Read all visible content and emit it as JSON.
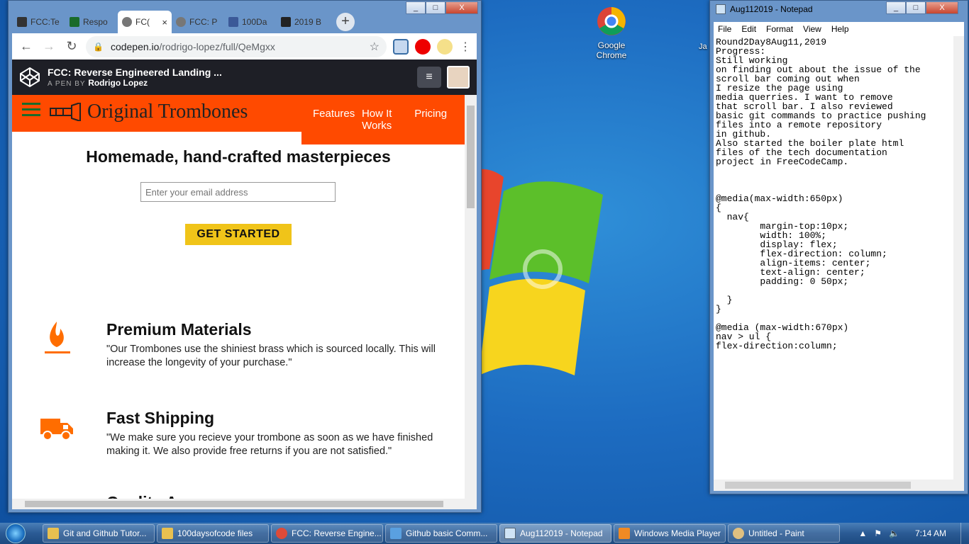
{
  "desktop": {
    "icons": [
      {
        "label_line1": "Google",
        "label_line2": "Chrome"
      }
    ],
    "edge_partial": "Ja"
  },
  "chrome": {
    "window_controls": [
      "_",
      "□",
      "X"
    ],
    "tabs": [
      {
        "label": "FCC:Te",
        "fav_color": "#333333"
      },
      {
        "label": "Respo",
        "fav_color": "#1a6b2a"
      },
      {
        "label": "FC(",
        "fav_color": "#555555",
        "active": true
      },
      {
        "label": "FCC: P",
        "fav_color": "#555555"
      },
      {
        "label": "100Da",
        "fav_color": "#3b5998"
      },
      {
        "label": "2019 B",
        "fav_color": "#222222"
      }
    ],
    "new_tab": "+",
    "url_host": "codepen.io",
    "url_path": "/rodrigo-lopez/full/QeMgxx",
    "codepen": {
      "title": "FCC: Reverse Engineered Landing ...",
      "by_label": "A PEN BY",
      "author": "Rodrigo Lopez"
    },
    "page": {
      "brand": "Original Trombones",
      "nav": [
        "Features",
        "How It Works",
        "Pricing"
      ],
      "hero_title": "Homemade, hand-crafted masterpieces",
      "email_placeholder": "Enter your email address",
      "cta": "GET STARTED",
      "features": [
        {
          "title": "Premium Materials",
          "text": "\"Our Trombones use the shiniest brass which is sourced locally. This will increase the longevity of your purchase.\"",
          "icon": "fire-icon"
        },
        {
          "title": "Fast Shipping",
          "text": "\"We make sure you recieve your trombone as soon as we have finished making it. We also provide free returns if you are not satisfied.\"",
          "icon": "truck-icon"
        }
      ],
      "cutoff_heading": "Quality A"
    }
  },
  "notepad": {
    "title": "Aug112019 - Notepad",
    "menu": [
      "File",
      "Edit",
      "Format",
      "View",
      "Help"
    ],
    "content": "Round2Day8Aug11,2019\nProgress:\nStill working\non finding out about the issue of the\nscroll bar coming out when\nI resize the page using\nmedia querries. I want to remove\nthat scroll bar. I also reviewed\nbasic git commands to practice pushing\nfiles into a remote repository\nin github.\nAlso started the boiler plate html\nfiles of the tech documentation\nproject in FreeCodeCamp.\n\n\n\n@media(max-width:650px)\n{\n  nav{\n        margin-top:10px;\n        width: 100%;\n        display: flex;\n        flex-direction: column;\n        align-items: center;\n        text-align: center;\n        padding: 0 50px;\n\n  }\n}\n\n@media (max-width:670px)\nnav > ul {\nflex-direction:column;"
  },
  "taskbar": {
    "items": [
      {
        "label": "Git and Github Tutor...",
        "icon_color": "#e8c050"
      },
      {
        "label": "100daysofcode files",
        "icon_color": "#e8c050"
      },
      {
        "label": "FCC: Reverse Engine...",
        "icon_color": "#dd4b39"
      },
      {
        "label": "Github basic Comm...",
        "icon_color": "#5aa0e0"
      },
      {
        "label": "Aug112019 - Notepad",
        "icon_color": "#cfe3f5",
        "active": true
      },
      {
        "label": "Windows Media Player",
        "icon_color": "#f08a24"
      },
      {
        "label": "Untitled - Paint",
        "icon_color": "#e0c080"
      }
    ],
    "clock": "7:14 AM"
  }
}
